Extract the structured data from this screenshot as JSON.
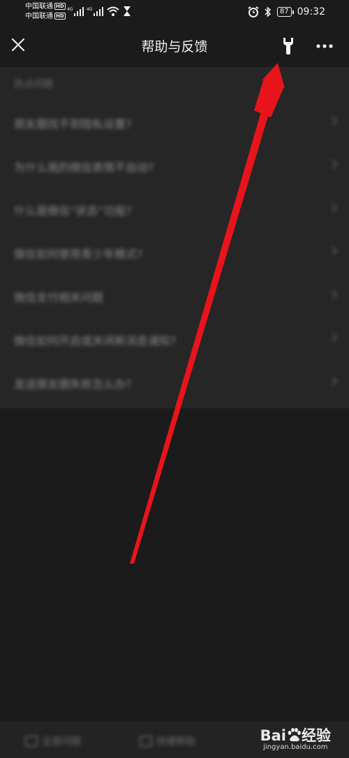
{
  "status_bar": {
    "carrier_1": "中国联通",
    "carrier_2": "中国联通",
    "hd_badge": "HD",
    "network_1": "4G",
    "network_2": "4G",
    "battery": "87",
    "time": "09:32"
  },
  "header": {
    "title": "帮助与反馈"
  },
  "faq": {
    "section_title": "热点问题",
    "items": [
      {
        "label": "朋友圈找不到隐私设置?"
      },
      {
        "label": "为什么我的微信表情不自动?"
      },
      {
        "label": "什么是微信“状态”功能?"
      },
      {
        "label": "微信如何使用青少年模式?"
      },
      {
        "label": "微信支付相关问题"
      },
      {
        "label": "微信如何开启或关闭新消息通知?"
      },
      {
        "label": "发送朋友圈失败怎么办?"
      }
    ]
  },
  "bottom_bar": {
    "tab_1": "全部问题",
    "tab_2": "快捷帮助"
  },
  "watermark": {
    "logo_left": "Bai",
    "logo_right": "经验",
    "url": "jingyan.baidu.com"
  },
  "colors": {
    "background": "#1b1b1b",
    "card": "#262626",
    "annotation_arrow": "#e8141b"
  }
}
